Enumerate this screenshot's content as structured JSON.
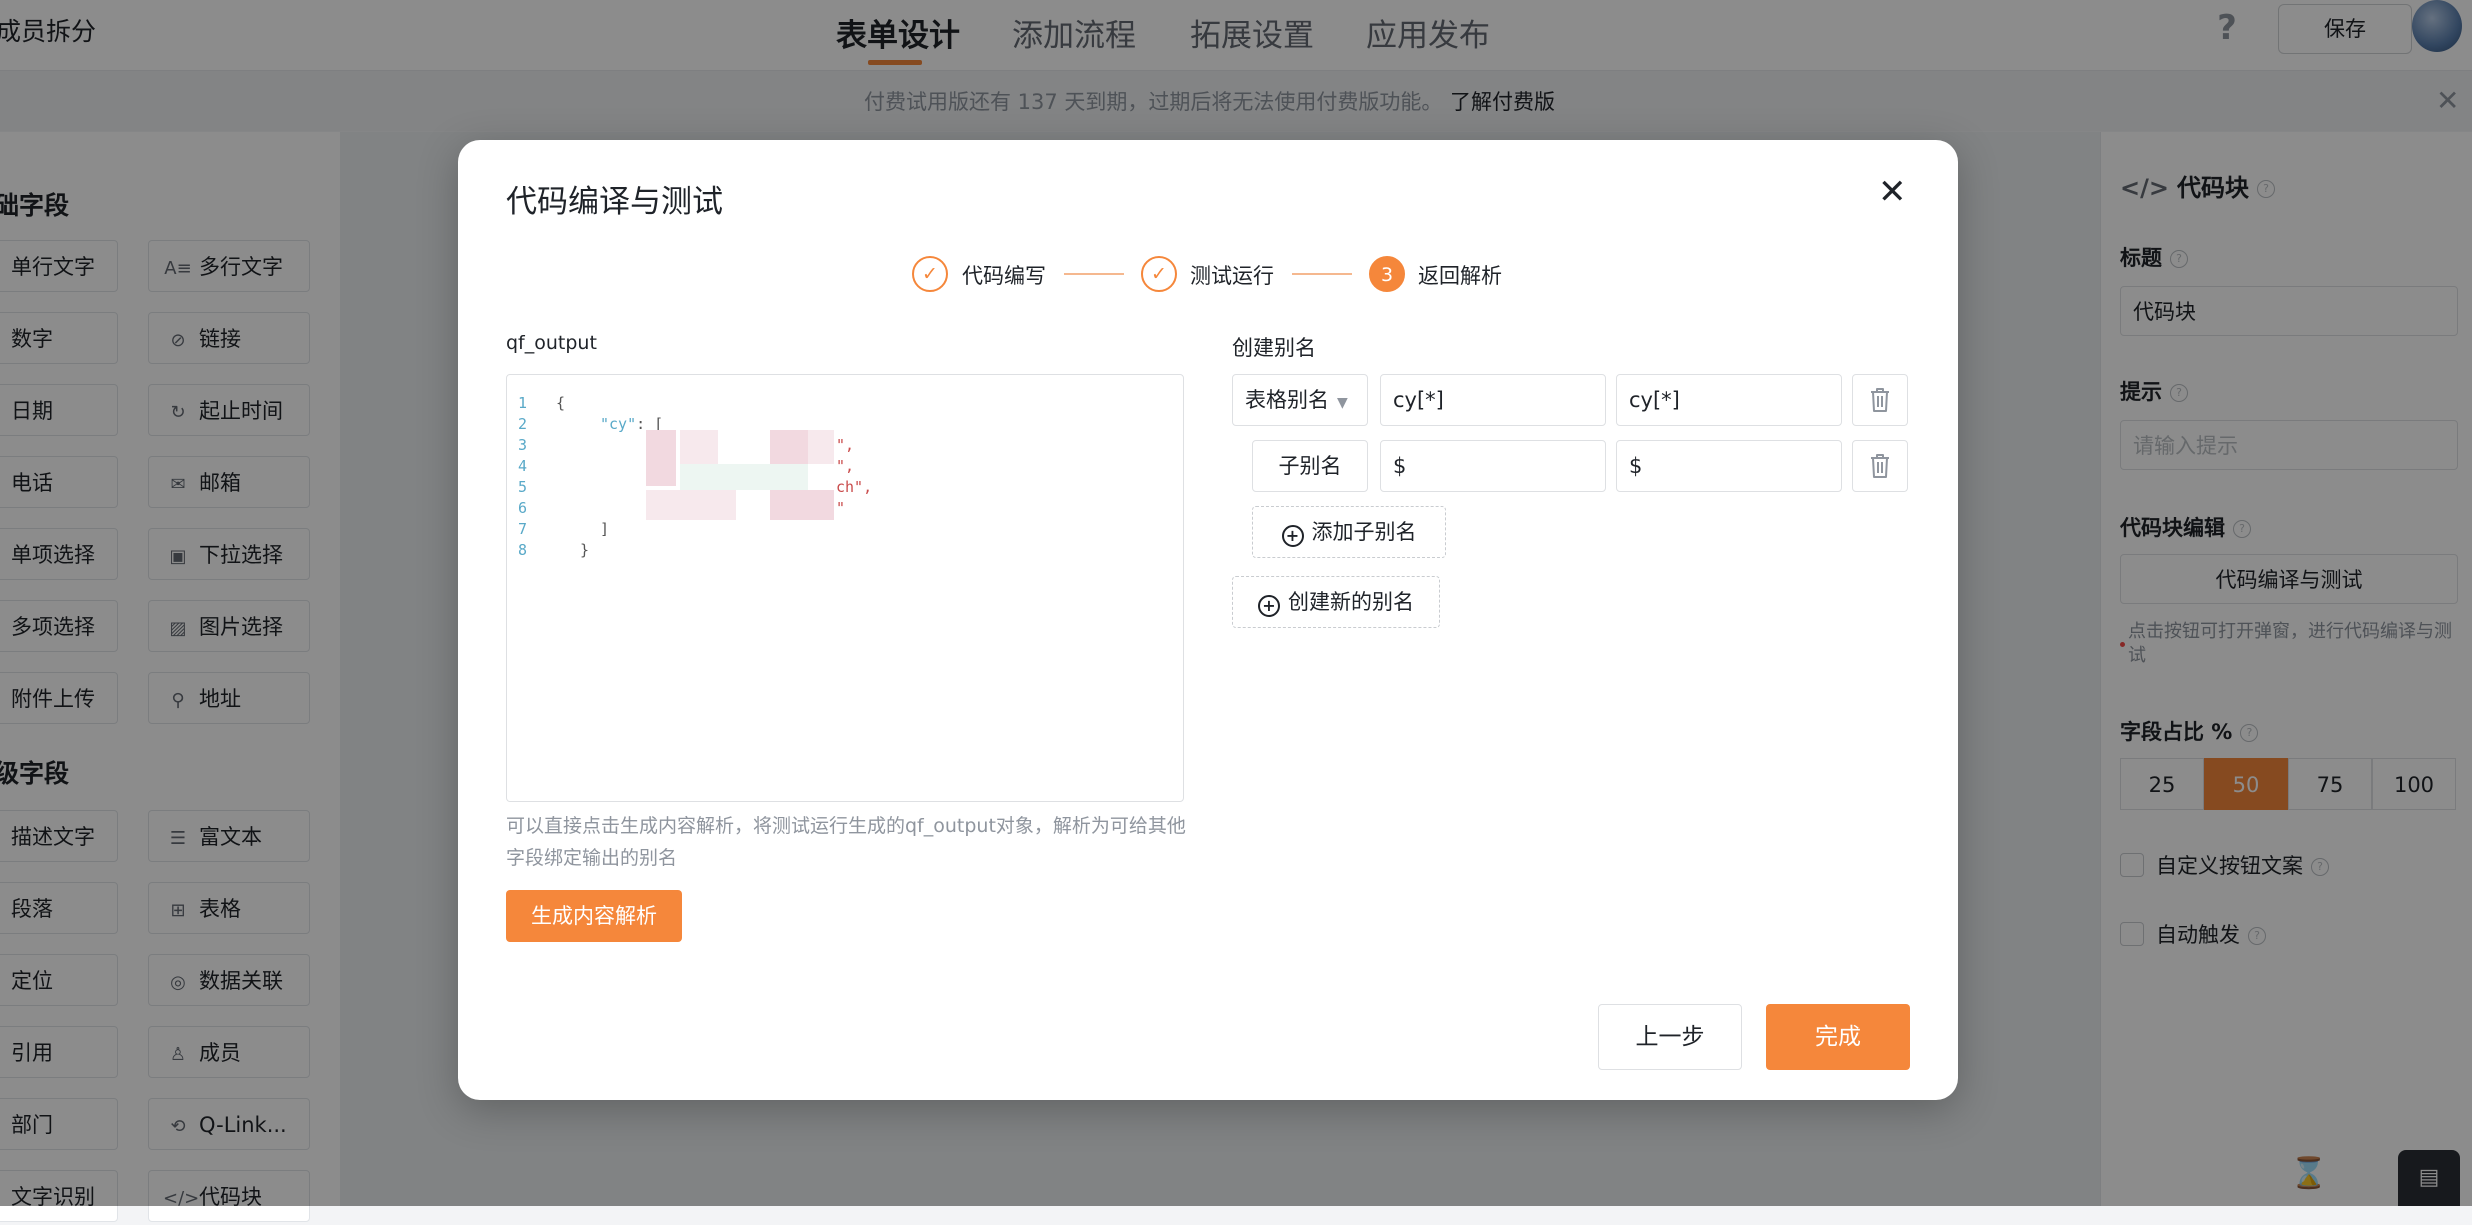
{
  "app": {
    "title": "成员拆分",
    "tabs": [
      "表单设计",
      "添加流程",
      "拓展设置",
      "应用发布"
    ],
    "help_icon": "?",
    "save_label": "保存",
    "notice": "付费试用版还有 137 天到期，过期后将无法使用付费版功能。",
    "notice_link": "了解付费版",
    "close_glyph": "✕"
  },
  "left_panel": {
    "section1_title": "础字段",
    "section2_title": "级字段",
    "fields": [
      {
        "label": "单行文字",
        "icon": ""
      },
      {
        "label": "多行文字",
        "icon": "multiline-text-icon"
      },
      {
        "label": "数字",
        "icon": ""
      },
      {
        "label": "链接",
        "icon": "link-icon"
      },
      {
        "label": "日期",
        "icon": ""
      },
      {
        "label": "起止时间",
        "icon": "time-range-icon"
      },
      {
        "label": "电话",
        "icon": ""
      },
      {
        "label": "邮箱",
        "icon": "mail-icon"
      },
      {
        "label": "单项选择",
        "icon": ""
      },
      {
        "label": "下拉选择",
        "icon": "dropdown-icon"
      },
      {
        "label": "多项选择",
        "icon": ""
      },
      {
        "label": "图片选择",
        "icon": "image-icon"
      },
      {
        "label": "附件上传",
        "icon": ""
      },
      {
        "label": "地址",
        "icon": "address-icon"
      }
    ],
    "advanced": [
      {
        "label": "描述文字",
        "icon": ""
      },
      {
        "label": "富文本",
        "icon": "rich-text-icon"
      },
      {
        "label": "段落",
        "icon": ""
      },
      {
        "label": "表格",
        "icon": "table-icon"
      },
      {
        "label": "定位",
        "icon": ""
      },
      {
        "label": "数据关联",
        "icon": "data-link-icon"
      },
      {
        "label": "引用",
        "icon": ""
      },
      {
        "label": "成员",
        "icon": "member-icon"
      },
      {
        "label": "部门",
        "icon": ""
      },
      {
        "label": "Q-Link...",
        "icon": "qlink-icon"
      },
      {
        "label": "文字识别",
        "icon": ""
      },
      {
        "label": "代码块",
        "icon": "code-icon"
      }
    ]
  },
  "right_panel": {
    "header": "代码块",
    "title_label": "标题",
    "title_value": "代码块",
    "hint_label": "提示",
    "hint_placeholder": "请输入提示",
    "code_edit_label": "代码块编辑",
    "code_edit_button": "代码编译与测试",
    "code_edit_hint": "点击按钮可打开弹窗，进行代码编译与测试",
    "ratio_label": "字段占比 %",
    "ratios": [
      "25",
      "50",
      "75",
      "100"
    ],
    "ratio_selected": "50",
    "custom_button_text": "自定义按钮文案",
    "auto_trigger": "自动触发"
  },
  "modal": {
    "title": "代码编译与测试",
    "close": "✕",
    "steps": [
      {
        "label": "代码编写",
        "marker": "✓"
      },
      {
        "label": "测试运行",
        "marker": "✓"
      },
      {
        "label": "返回解析",
        "marker": "3"
      }
    ],
    "current_step": 3,
    "output_label": "qf_output",
    "code_lines": [
      {
        "n": "1",
        "text": "{"
      },
      {
        "n": "2",
        "key": "\"cy\"",
        "text": ": ["
      },
      {
        "n": "3",
        "text": "\","
      },
      {
        "n": "4",
        "text": "\","
      },
      {
        "n": "5",
        "text": "ch\","
      },
      {
        "n": "6",
        "text": "\""
      },
      {
        "n": "7",
        "text": "]"
      },
      {
        "n": "8",
        "text": "}"
      }
    ],
    "editor_hint": "可以直接点击生成内容解析，将测试运行生成的qf_output对象，解析为可给其他字段绑定输出的别名",
    "generate_button": "生成内容解析",
    "alias_section_label": "创建别名",
    "alias_rows": [
      {
        "type": "表格别名",
        "name": "cy[*]",
        "path": "cy[*]"
      },
      {
        "type": "子别名",
        "name": "$",
        "path": "$"
      }
    ],
    "add_sub_alias": "添加子别名",
    "create_alias": "创建新的别名",
    "prev_button": "上一步",
    "finish_button": "完成"
  },
  "colors": {
    "accent": "#f5873b",
    "overlay": "rgba(0,0,0,0.45)"
  }
}
